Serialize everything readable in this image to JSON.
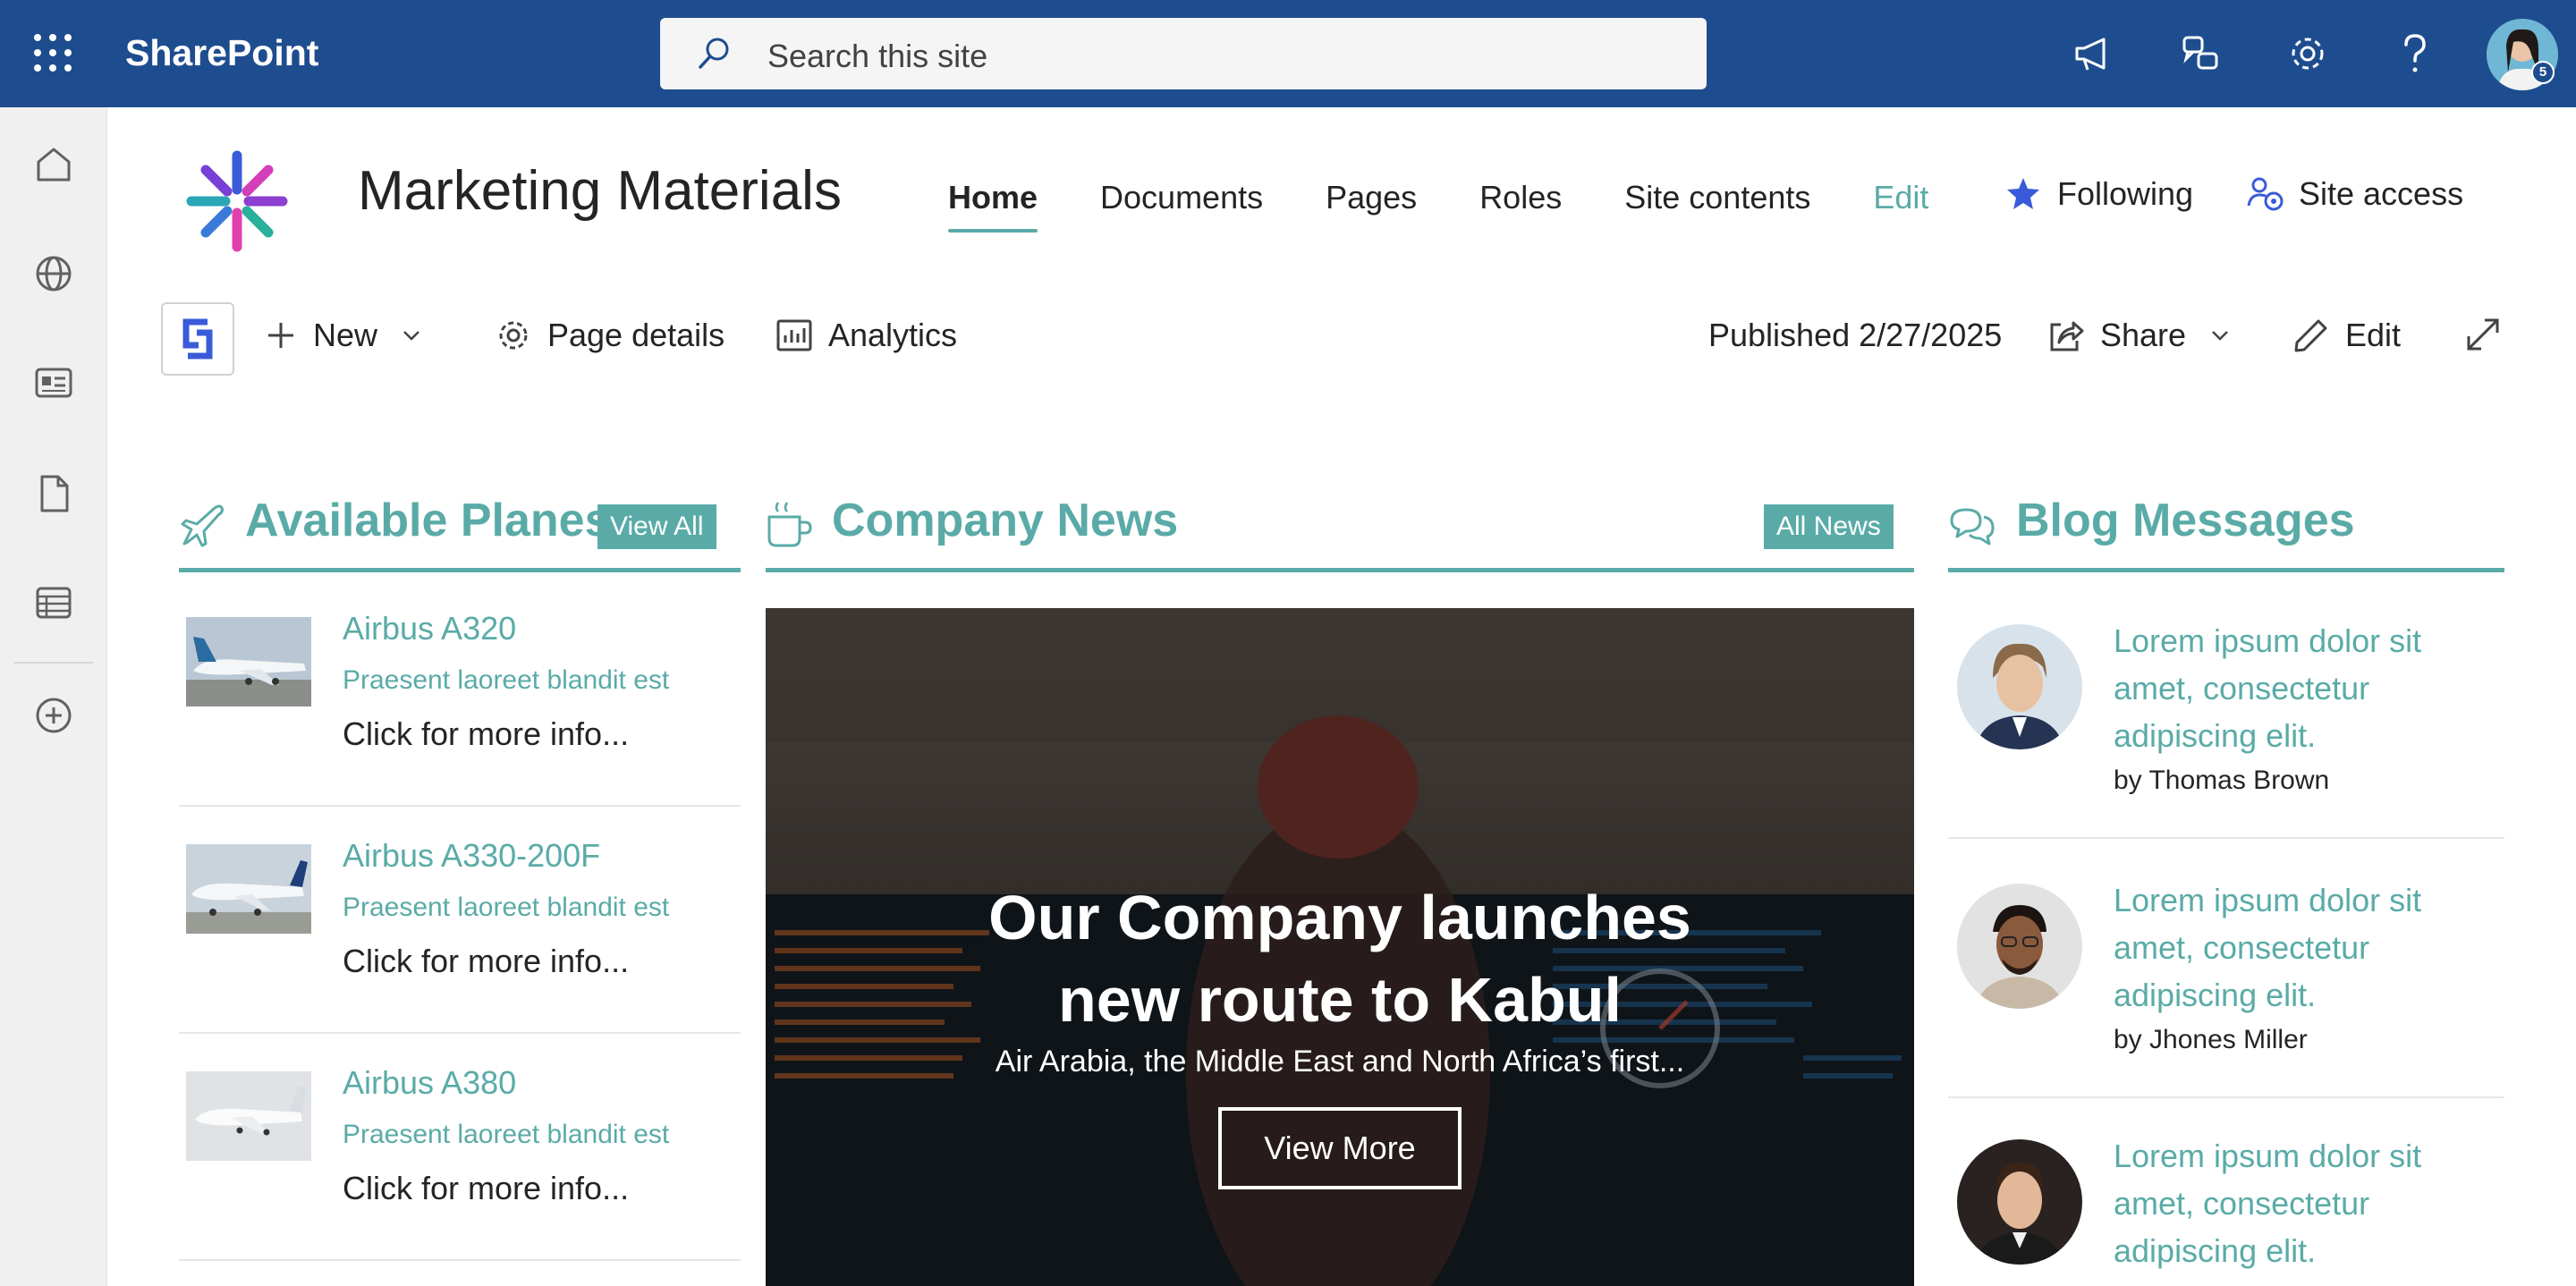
{
  "suite": {
    "app_name": "SharePoint",
    "search_placeholder": "Search this site",
    "avatar_badge": "5"
  },
  "site": {
    "title": "Marketing Materials",
    "nav": [
      "Home",
      "Documents",
      "Pages",
      "Roles",
      "Site contents",
      "Edit"
    ],
    "following_label": "Following",
    "site_access_label": "Site access"
  },
  "commandbar": {
    "new_label": "New",
    "page_details_label": "Page details",
    "analytics_label": "Analytics",
    "published": "Published 2/27/2025",
    "share_label": "Share",
    "edit_label": "Edit"
  },
  "planes": {
    "title": "Available Planes",
    "view_all": "View All",
    "items": [
      {
        "name": "Airbus A320",
        "desc": "Praesent laoreet blandit est",
        "more": "Click for more info..."
      },
      {
        "name": "Airbus A330-200F",
        "desc": "Praesent laoreet blandit est",
        "more": "Click for more info..."
      },
      {
        "name": "Airbus A380",
        "desc": "Praesent laoreet blandit est",
        "more": "Click for more info..."
      }
    ]
  },
  "news": {
    "title": "Company News",
    "all_news": "All News",
    "headline_line1": "Our Company launches",
    "headline_line2": "new route to Kabul",
    "subtitle": "Air Arabia, the Middle East and North Africa’s first...",
    "button": "View More"
  },
  "blog": {
    "title": "Blog Messages",
    "items": [
      {
        "text": "Lorem ipsum dolor sit amet, consectetur adipiscing elit.",
        "author": "by Thomas Brown"
      },
      {
        "text": "Lorem ipsum dolor sit amet, consectetur adipiscing elit.",
        "author": "by Jhones Miller"
      },
      {
        "text": "Lorem ipsum dolor sit amet, consectetur adipiscing elit.",
        "author": ""
      }
    ]
  },
  "colors": {
    "suite_bar": "#1e4d8f",
    "accent": "#5aaba7",
    "following_star": "#3a5bd9"
  }
}
